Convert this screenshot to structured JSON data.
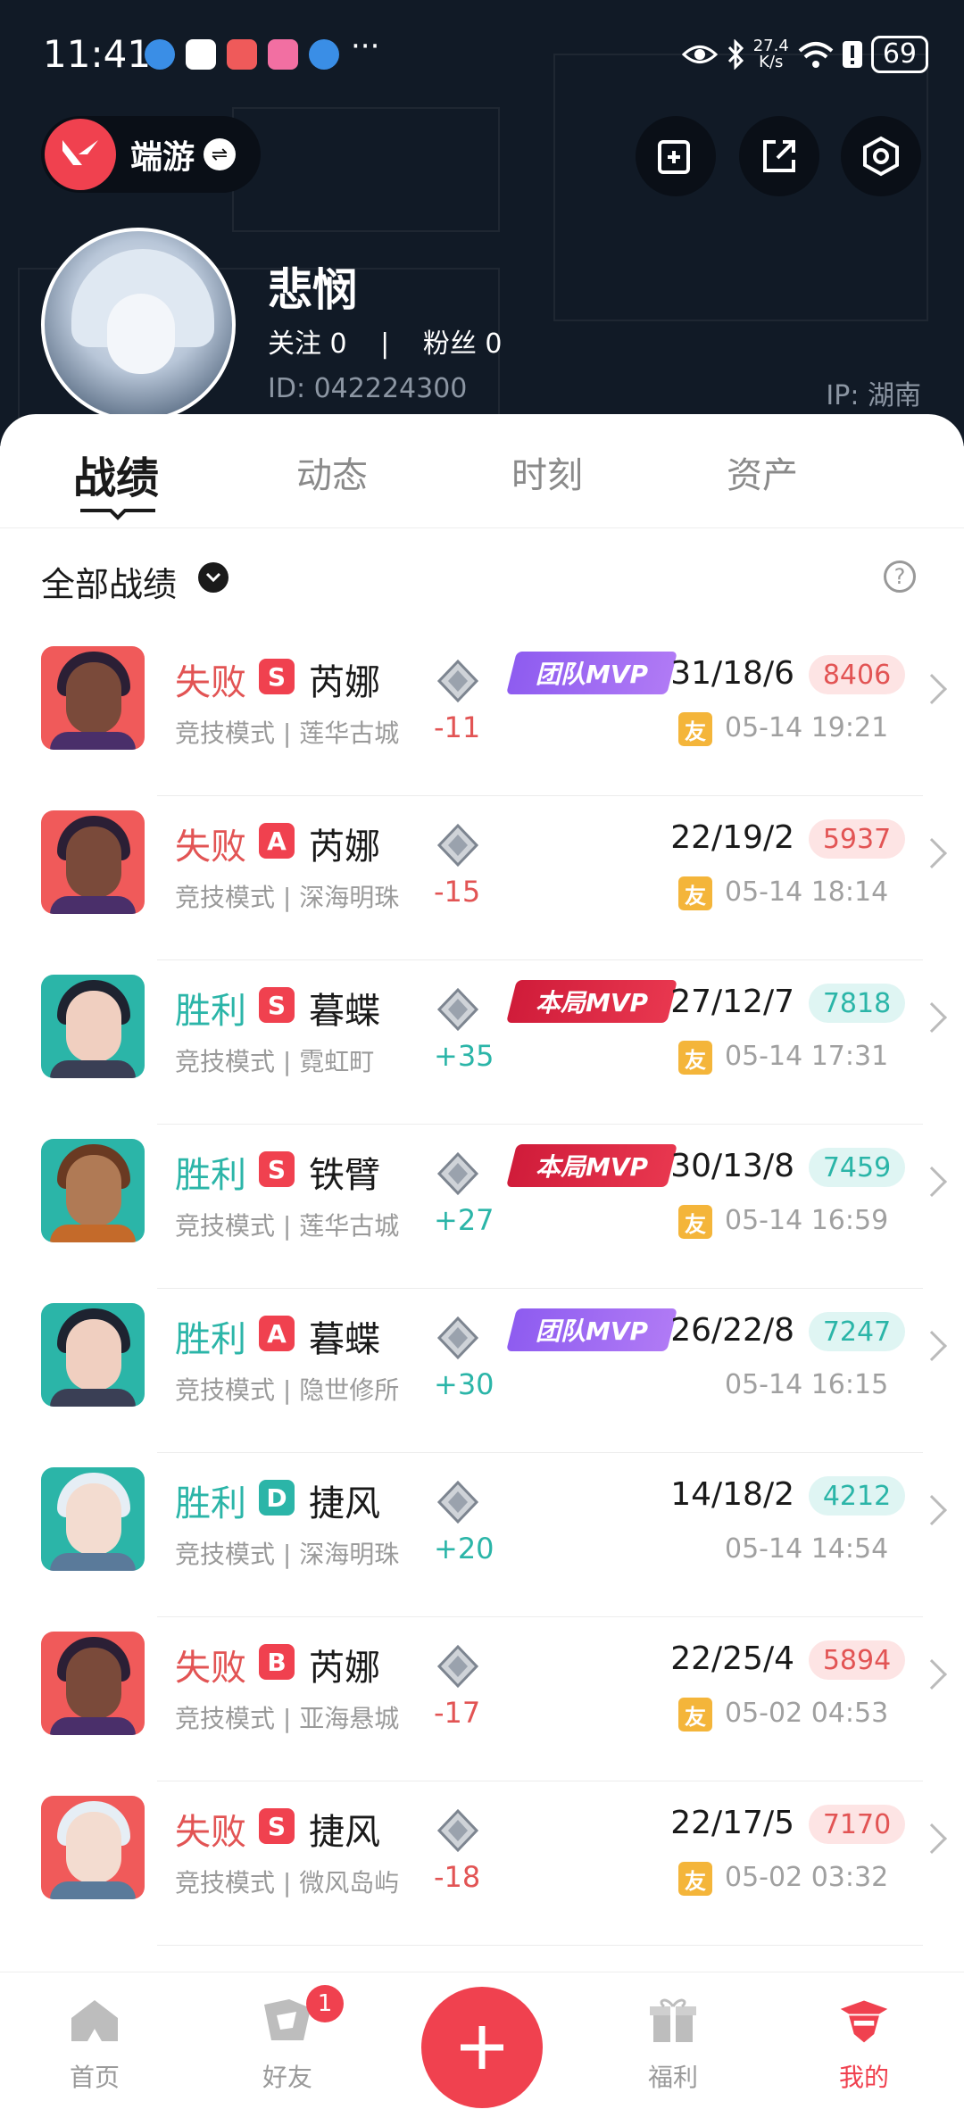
{
  "status_bar": {
    "time": "11:41",
    "network_speed": "27.4\nK/s",
    "battery": "69",
    "more": "···"
  },
  "header": {
    "game_name": "端游",
    "user_name": "悲悯",
    "follow_text": "关注 0",
    "fans_text": "粉丝 0",
    "follow_sep": "|",
    "id_text": "ID:  042224300",
    "ip_text": "IP:  湖南"
  },
  "tabs": [
    "战绩",
    "动态",
    "时刻",
    "资产"
  ],
  "filter": {
    "label": "全部战绩",
    "help": "?"
  },
  "matches": [
    {
      "result": "失败",
      "rank": "S",
      "hero": "芮娜",
      "mode": "竞技模式 | 莲华古城",
      "delta": "-11",
      "mvp": "团队MVP",
      "kda": "31/18/6",
      "score": "8406",
      "friend": "友",
      "date": "05-14 19:21"
    },
    {
      "result": "失败",
      "rank": "A",
      "hero": "芮娜",
      "mode": "竞技模式 | 深海明珠",
      "delta": "-15",
      "mvp": "",
      "kda": "22/19/2",
      "score": "5937",
      "friend": "友",
      "date": "05-14 18:14"
    },
    {
      "result": "胜利",
      "rank": "S",
      "hero": "暮蝶",
      "mode": "竞技模式 | 霓虹町",
      "delta": "+35",
      "mvp": "本局MVP",
      "kda": "27/12/7",
      "score": "7818",
      "friend": "友",
      "date": "05-14 17:31"
    },
    {
      "result": "胜利",
      "rank": "S",
      "hero": "铁臂",
      "mode": "竞技模式 | 莲华古城",
      "delta": "+27",
      "mvp": "本局MVP",
      "kda": "30/13/8",
      "score": "7459",
      "friend": "友",
      "date": "05-14 16:59"
    },
    {
      "result": "胜利",
      "rank": "A",
      "hero": "暮蝶",
      "mode": "竞技模式 | 隐世修所",
      "delta": "+30",
      "mvp": "团队MVP",
      "kda": "26/22/8",
      "score": "7247",
      "friend": "",
      "date": "05-14 16:15"
    },
    {
      "result": "胜利",
      "rank": "D",
      "hero": "捷风",
      "mode": "竞技模式 | 深海明珠",
      "delta": "+20",
      "mvp": "",
      "kda": "14/18/2",
      "score": "4212",
      "friend": "",
      "date": "05-14 14:54"
    },
    {
      "result": "失败",
      "rank": "B",
      "hero": "芮娜",
      "mode": "竞技模式 | 亚海悬城",
      "delta": "-17",
      "mvp": "",
      "kda": "22/25/4",
      "score": "5894",
      "friend": "友",
      "date": "05-02 04:53"
    },
    {
      "result": "失败",
      "rank": "S",
      "hero": "捷风",
      "mode": "竞技模式 | 微风岛屿",
      "delta": "-18",
      "mvp": "",
      "kda": "22/17/5",
      "score": "7170",
      "friend": "友",
      "date": "05-02 03:32"
    }
  ],
  "bottom_nav": {
    "home": "首页",
    "friends": "好友",
    "friends_badge": "1",
    "welfare": "福利",
    "mine": "我的"
  },
  "colors": {
    "accent": "#f0414f",
    "win": "#2bb5a8",
    "loss": "#e25454",
    "header_bg": "#111a26"
  }
}
